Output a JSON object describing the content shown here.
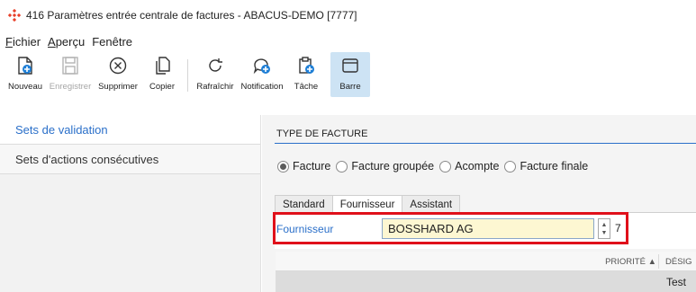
{
  "window": {
    "title": "416 Paramètres entrée centrale de factures - ABACUS-DEMO [7777]"
  },
  "menu": {
    "items": [
      {
        "mnemonic": "F",
        "rest": "ichier"
      },
      {
        "mnemonic": "A",
        "rest": "perçu"
      },
      {
        "mnemonic": "",
        "rest": "Fenêtre"
      }
    ]
  },
  "toolbar": {
    "nouveau": "Nouveau",
    "enregistrer": "Enregistrer",
    "supprimer": "Supprimer",
    "copier": "Copier",
    "rafraichir": "Rafraîchir",
    "notification": "Notification",
    "tache": "Tâche",
    "barre": "Barre"
  },
  "sidebar": {
    "items": [
      {
        "label": "Sets de validation",
        "selected": true
      },
      {
        "label": "Sets d'actions consécutives",
        "selected": false
      }
    ]
  },
  "main": {
    "section_title": "TYPE DE FACTURE",
    "invoice_types": [
      {
        "label": "Facture",
        "checked": true
      },
      {
        "label": "Facture groupée",
        "checked": false
      },
      {
        "label": "Acompte",
        "checked": false
      },
      {
        "label": "Facture finale",
        "checked": false
      }
    ],
    "tabs": [
      {
        "label": "Standard",
        "active": false
      },
      {
        "label": "Fournisseur",
        "active": true
      },
      {
        "label": "Assistant",
        "active": false
      }
    ],
    "supplier": {
      "label": "Fournisseur",
      "value": "BOSSHARD AG",
      "number": "7"
    },
    "grid": {
      "columns": [
        "PRIORITÉ ▲",
        "DÉSIG"
      ],
      "rows": [
        {
          "designation": "Test"
        }
      ]
    }
  },
  "colors": {
    "accent": "#2a6fc9",
    "highlight_border": "#e0101a",
    "input_bg": "#fdf7d2",
    "brand": "#e8412b"
  }
}
